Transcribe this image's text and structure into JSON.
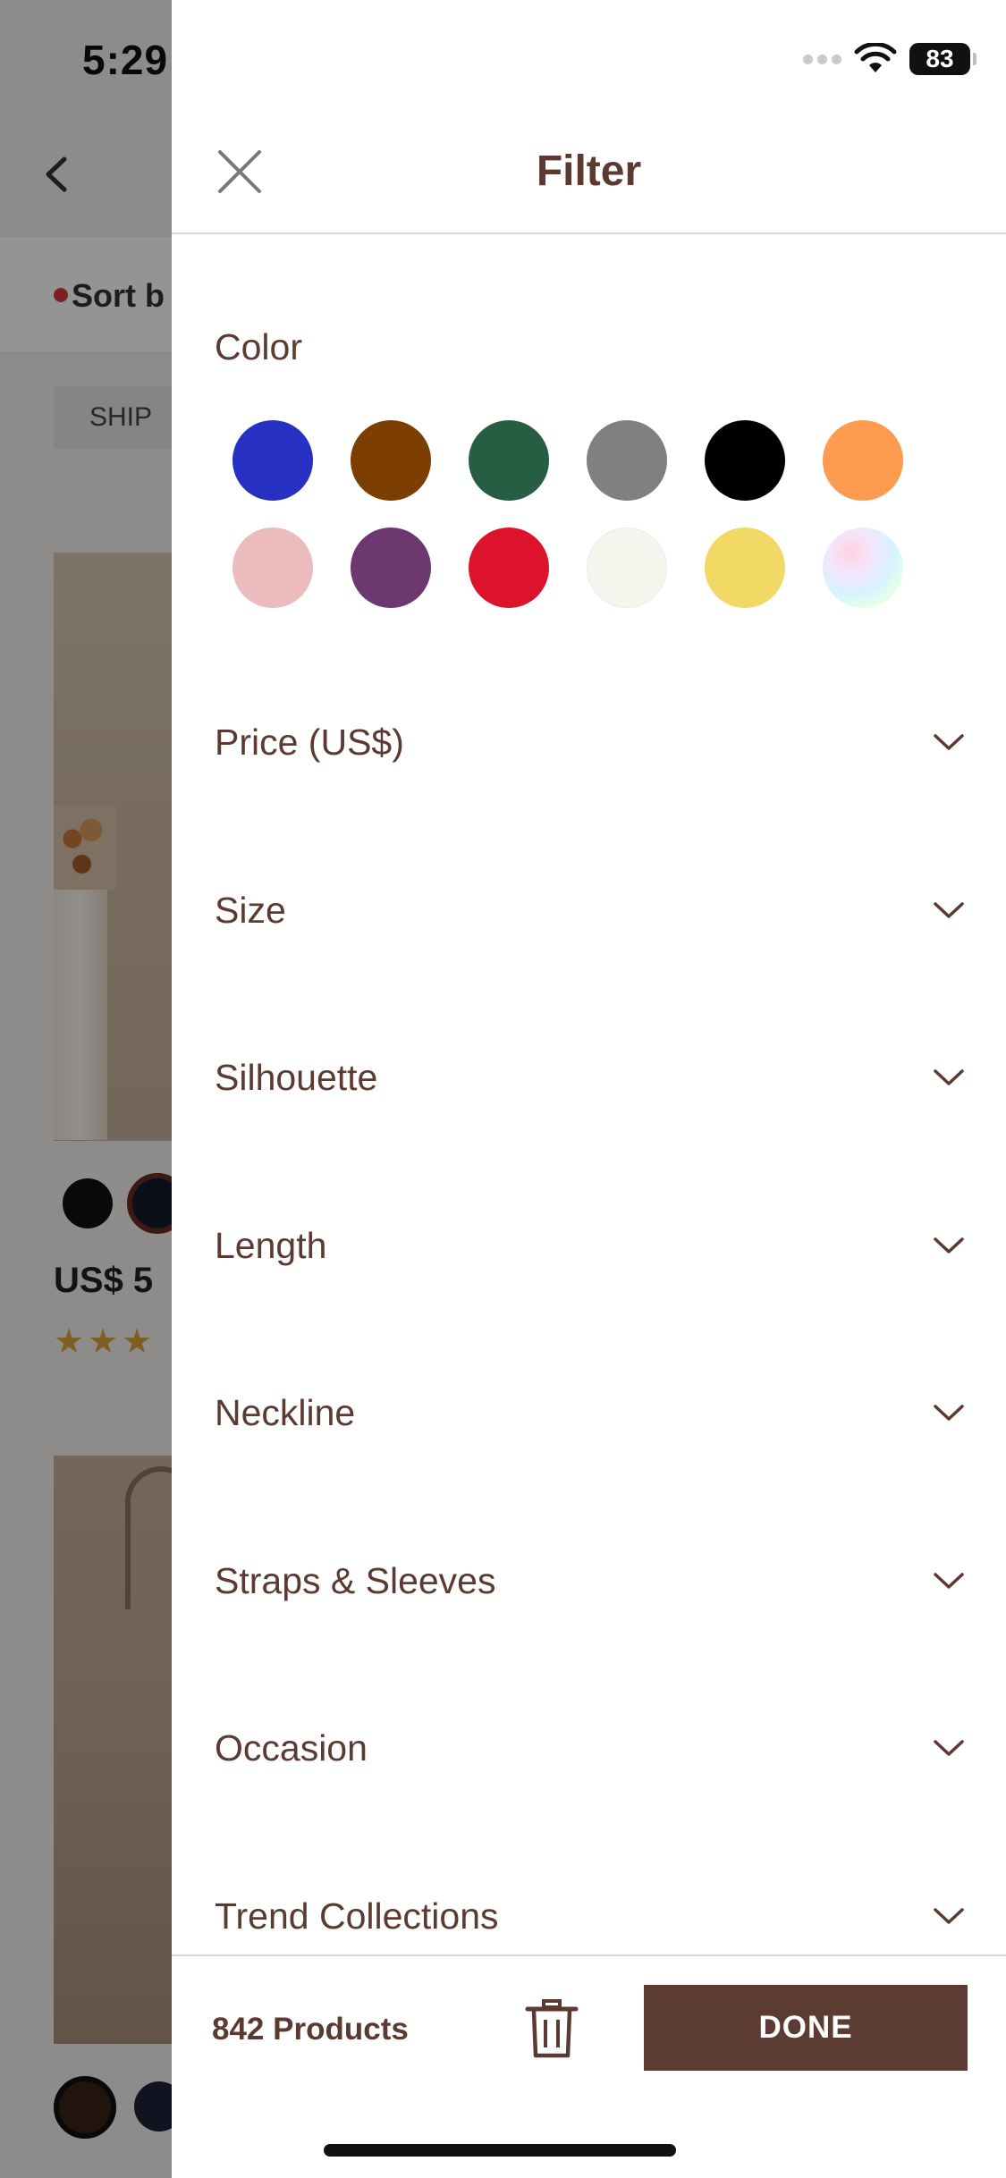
{
  "status_bar": {
    "time": "5:29",
    "battery": "83"
  },
  "background": {
    "sort_label": "Sort b",
    "chip_label": "SHIP",
    "price": "US$ 5",
    "stars": "★★★"
  },
  "filter": {
    "title": "Filter",
    "color_section": {
      "label": "Color",
      "swatches": [
        {
          "name": "blue",
          "color": "#2631c2"
        },
        {
          "name": "brown",
          "color": "#7d3e02"
        },
        {
          "name": "green",
          "color": "#265e43"
        },
        {
          "name": "grey",
          "color": "#808080"
        },
        {
          "name": "black",
          "color": "#000000"
        },
        {
          "name": "orange",
          "color": "#fd9b50"
        },
        {
          "name": "pink",
          "color": "#ecbbbd"
        },
        {
          "name": "purple",
          "color": "#6d3870"
        },
        {
          "name": "red",
          "color": "#dd132c"
        },
        {
          "name": "ivory",
          "color": "#f6f6ef"
        },
        {
          "name": "yellow",
          "color": "#f2d864"
        },
        {
          "name": "multi",
          "color": "iridescent"
        }
      ]
    },
    "facets": [
      {
        "label": "Price (US$)"
      },
      {
        "label": "Size"
      },
      {
        "label": "Silhouette"
      },
      {
        "label": "Length"
      },
      {
        "label": "Neckline"
      },
      {
        "label": "Straps & Sleeves"
      },
      {
        "label": "Occasion"
      },
      {
        "label": "Trend Collections"
      }
    ],
    "footer": {
      "product_count": "842 Products",
      "done_label": "DONE"
    }
  },
  "icons": {
    "close": "close-icon",
    "chevron": "chevron-down-icon",
    "trash": "trash-icon",
    "back": "chevron-left-icon",
    "wifi": "wifi-icon",
    "battery": "battery-icon"
  },
  "colors": {
    "accent": "#5c3b32",
    "text": "#5b3b31",
    "divider": "#d7d7d7"
  }
}
